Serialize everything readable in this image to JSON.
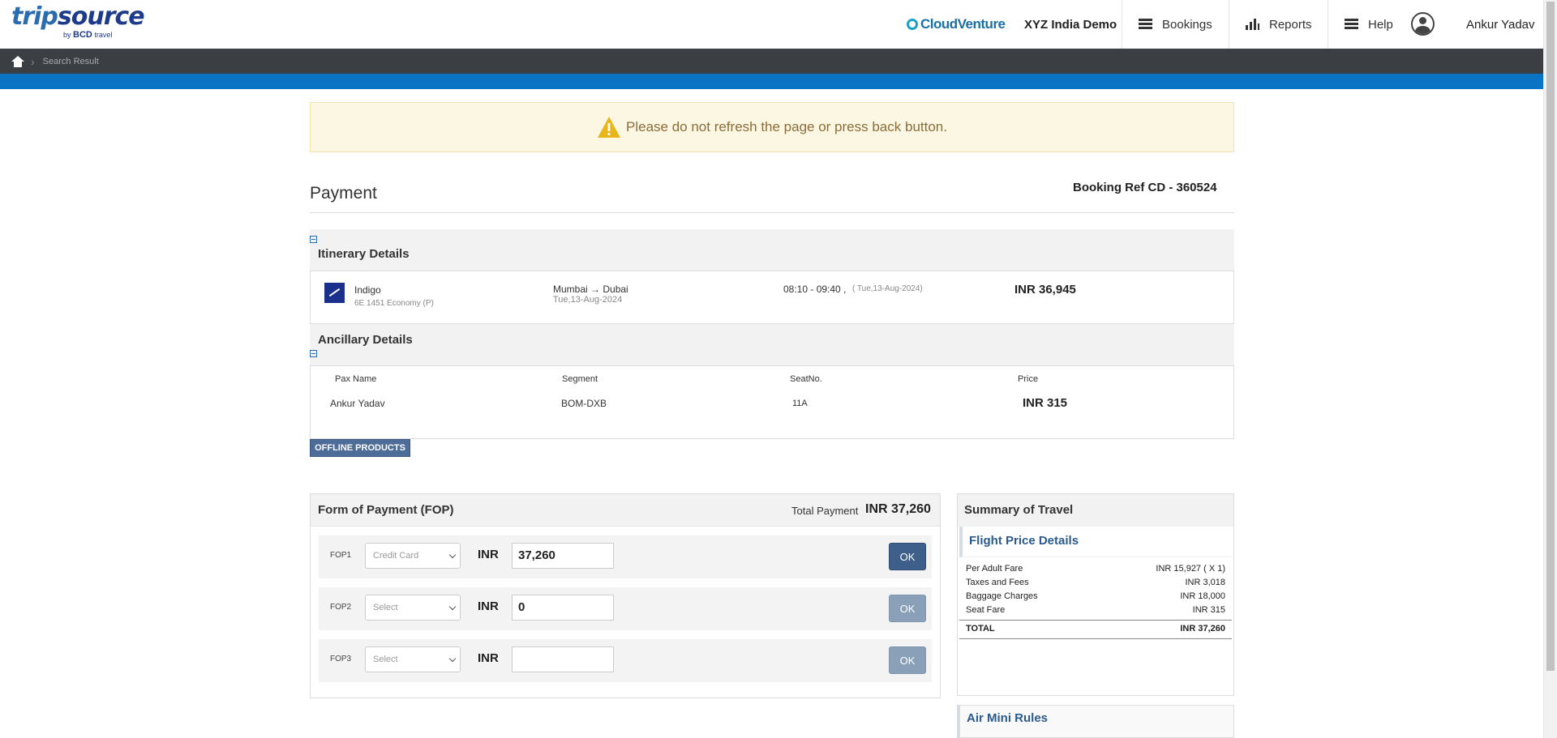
{
  "header": {
    "logo_main": "trip",
    "logo_main2": "source",
    "logo_by": "by",
    "logo_bcd": "BCD",
    "logo_travel": "travel",
    "cloud_venture": "CloudVenture",
    "org_name": "XYZ India Demo",
    "nav": [
      {
        "label": "Bookings",
        "icon": "hamburger-icon"
      },
      {
        "label": "Reports",
        "icon": "bar-chart-icon"
      },
      {
        "label": "Help",
        "icon": "hamburger-icon"
      }
    ],
    "user_name": "Ankur Yadav"
  },
  "breadcrumb": {
    "home_icon": "home-icon",
    "current": "Search Result"
  },
  "warning": {
    "text": "Please do not refresh the page or press back button.",
    "icon": "warning-icon",
    "color": "#e8b51a"
  },
  "payment": {
    "title": "Payment",
    "booking_ref": "Booking Ref CD - 360524"
  },
  "itinerary": {
    "title": "Itinerary Details",
    "airline": "Indigo",
    "flight": "6E 1451 Economy (P)",
    "route": "Mumbai → Dubai",
    "route_date": "Tue,13-Aug-2024",
    "time": "08:10 - 09:40 ,",
    "time_date": "( Tue,13-Aug-2024)",
    "price": "INR 36,945"
  },
  "ancillary": {
    "title": "Ancillary Details",
    "columns": [
      "Pax Name",
      "Segment",
      "SeatNo.",
      "Price"
    ],
    "rows": [
      {
        "pax": "Ankur Yadav",
        "segment": "BOM-DXB",
        "seat": "11A",
        "price": "INR 315"
      }
    ]
  },
  "offline_button": "OFFLINE PRODUCTS",
  "fop": {
    "title": "Form of Payment (FOP)",
    "total_label": "Total Payment",
    "total_value": "INR 37,260",
    "rows": [
      {
        "label": "FOP1",
        "select": "Credit Card",
        "currency": "INR",
        "amount": "37,260",
        "ok": "OK"
      },
      {
        "label": "FOP2",
        "select": "Select",
        "currency": "INR",
        "amount": "0",
        "ok": "OK"
      },
      {
        "label": "FOP3",
        "select": "Select",
        "currency": "INR",
        "amount": "",
        "ok": "OK"
      }
    ]
  },
  "summary": {
    "title": "Summary of Travel",
    "flight_price_title": "Flight Price Details",
    "rows": [
      {
        "label": "Per Adult Fare",
        "value": "INR 15,927 ( X 1)"
      },
      {
        "label": "Taxes and Fees",
        "value": "INR 3,018"
      },
      {
        "label": "Baggage Charges",
        "value": "INR 18,000"
      },
      {
        "label": "Seat Fare",
        "value": "INR 315"
      }
    ],
    "total_label": "TOTAL",
    "total_value": "INR 37,260",
    "air_mini_rules": "Air Mini Rules"
  },
  "colors": {
    "accent_blue": "#0a73c4",
    "dark_bar": "#3b3f43",
    "button_blue": "#3e5f8a",
    "link_blue": "#2b5b8c"
  }
}
